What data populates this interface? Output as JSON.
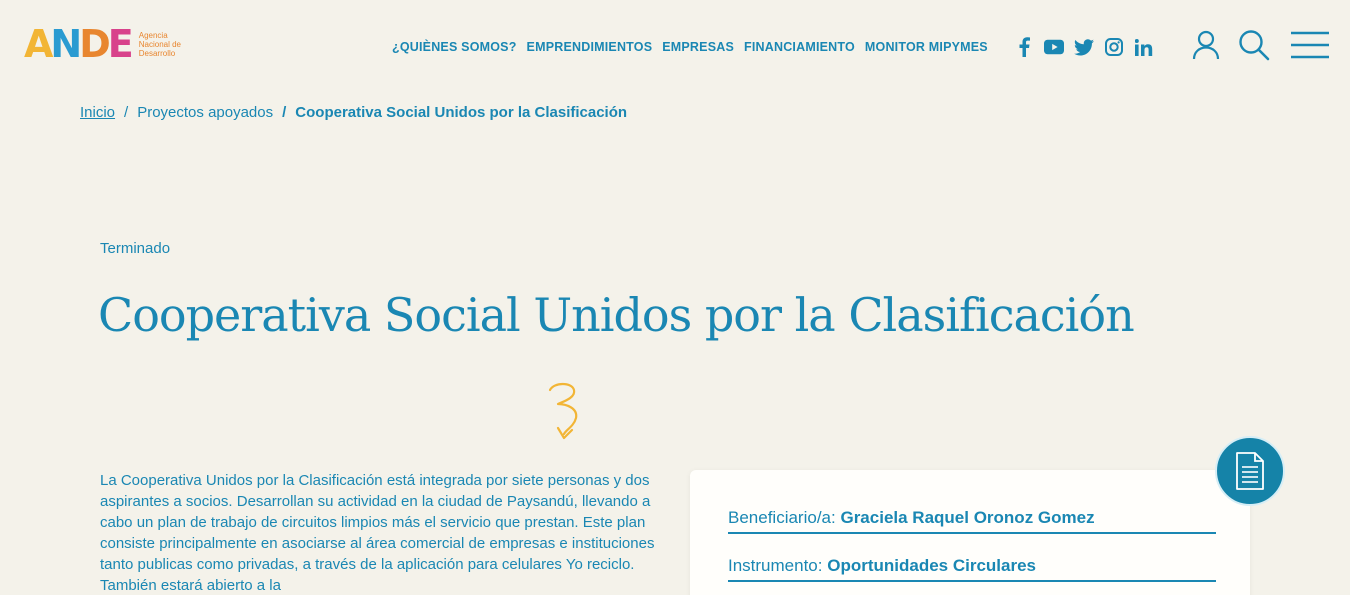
{
  "brand": {
    "logo_letters": [
      "A",
      "N",
      "D",
      "E"
    ],
    "logo_colors": [
      "#f2b535",
      "#2a9bd1",
      "#e8862f",
      "#d8428b"
    ],
    "logo_text": "Agencia Nacional de Desarrollo"
  },
  "nav": {
    "items": [
      {
        "label": "¿QUIÈNES SOMOS?"
      },
      {
        "label": "EMPRENDIMIENTOS"
      },
      {
        "label": "EMPRESAS"
      },
      {
        "label": "FINANCIAMIENTO"
      },
      {
        "label": "MONITOR MIPYMES"
      }
    ]
  },
  "social": [
    "facebook-icon",
    "youtube-icon",
    "twitter-icon",
    "instagram-icon",
    "linkedin-icon"
  ],
  "breadcrumb": {
    "home": "Inicio",
    "section": "Proyectos apoyados",
    "current": "Cooperativa Social Unidos por la Clasificación",
    "separator": "/"
  },
  "project": {
    "status": "Terminado",
    "title": "Cooperativa Social Unidos por la Clasificación",
    "description": "La Cooperativa Unidos por la Clasificación está integrada por siete personas y dos aspirantes a socios. Desarrollan su actividad en la ciudad de Paysandú, llevando a cabo un plan de trabajo de circuitos limpios más el servicio que prestan. Este plan consiste principalmente en asociarse al área comercial de empresas e instituciones tanto publicas como privadas, a través de la aplicación para celulares Yo reciclo. También estará abierto a la"
  },
  "info": {
    "beneficiary_label": "Beneficiario/a:",
    "beneficiary_value": "Graciela Raquel Oronoz Gomez",
    "instrument_label": "Instrumento:",
    "instrument_value": "Oportunidades Circulares"
  },
  "colors": {
    "primary": "#1a87b3",
    "background": "#f4f2ea",
    "accent": "#f2b535"
  }
}
